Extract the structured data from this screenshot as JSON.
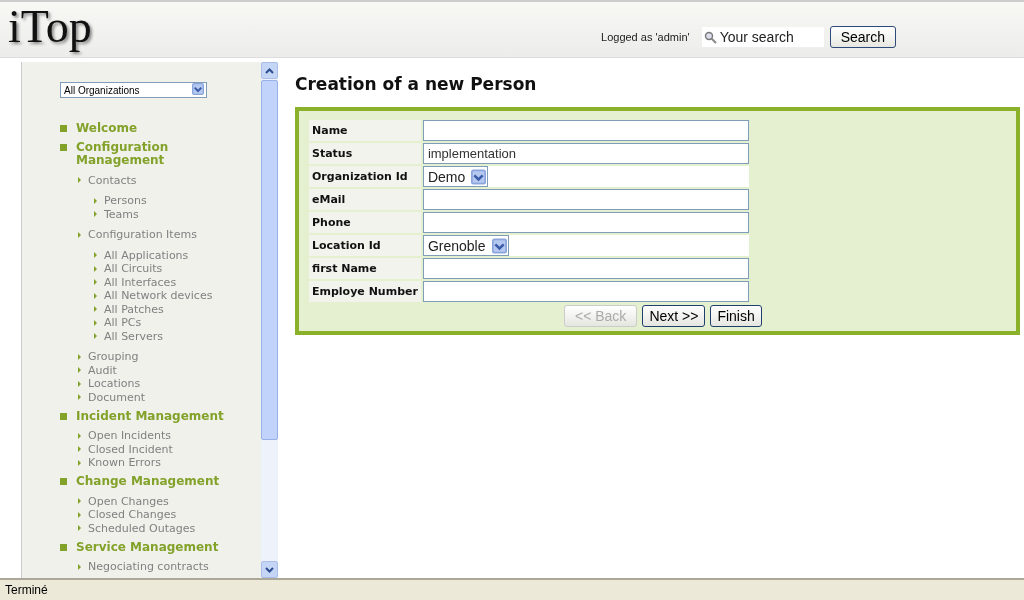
{
  "header": {
    "logo": "iTop",
    "logged_as": "Logged as 'admin'",
    "search": {
      "placeholder": "Your search"
    },
    "search_button": "Search"
  },
  "sidebar": {
    "organization": "All Organizations",
    "menu": [
      {
        "label": "Welcome"
      },
      {
        "label": "Configuration Management",
        "children": [
          {
            "label": "Contacts",
            "children": [
              {
                "label": "Persons"
              },
              {
                "label": "Teams"
              }
            ]
          },
          {
            "label": "Configuration Items",
            "children": [
              {
                "label": "All Applications"
              },
              {
                "label": "All Circuits"
              },
              {
                "label": "All Interfaces"
              },
              {
                "label": "All Network devices"
              },
              {
                "label": "All Patches"
              },
              {
                "label": "All PCs"
              },
              {
                "label": "All Servers"
              }
            ]
          },
          {
            "label": "Grouping"
          },
          {
            "label": "Audit"
          },
          {
            "label": "Locations"
          },
          {
            "label": "Document"
          }
        ]
      },
      {
        "label": "Incident Management",
        "children": [
          {
            "label": "Open Incidents"
          },
          {
            "label": "Closed Incident"
          },
          {
            "label": "Known Errors"
          }
        ]
      },
      {
        "label": "Change Management",
        "children": [
          {
            "label": "Open Changes"
          },
          {
            "label": "Closed Changes"
          },
          {
            "label": "Scheduled Outages"
          }
        ]
      },
      {
        "label": "Service Management",
        "children": [
          {
            "label": "Negociating contracts"
          }
        ]
      }
    ]
  },
  "form": {
    "title": "Creation of a new Person",
    "fields": [
      {
        "label": "Name",
        "kind": "text"
      },
      {
        "label": "Status",
        "kind": "text",
        "value": "implementation"
      },
      {
        "label": "Organization Id",
        "kind": "select",
        "value": "Demo"
      },
      {
        "label": "eMail",
        "kind": "text"
      },
      {
        "label": "Phone",
        "kind": "text"
      },
      {
        "label": "Location Id",
        "kind": "select",
        "value": "Grenoble"
      },
      {
        "label": "first Name",
        "kind": "text"
      },
      {
        "label": "Employe Number",
        "kind": "text"
      }
    ],
    "buttons": [
      {
        "label": "<< Back",
        "disabled": true
      },
      {
        "label": "Next >>",
        "disabled": false
      },
      {
        "label": "Finish",
        "disabled": false
      }
    ]
  },
  "status_bar": "Terminé"
}
